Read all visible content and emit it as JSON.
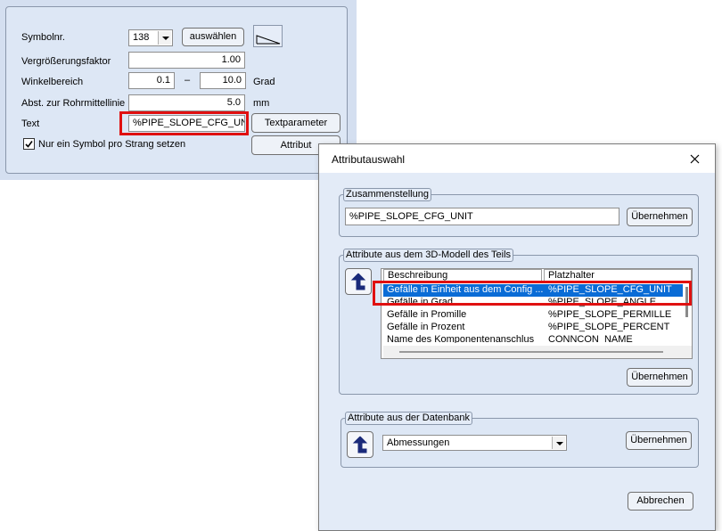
{
  "main_panel": {
    "symbolnr_label": "Symbolnr.",
    "symbolnr_value": "138",
    "select_button": "auswählen",
    "factor_label": "Vergrößerungsfaktor",
    "factor_value": "1.00",
    "angle_label": "Winkelbereich",
    "angle_from": "0.1",
    "angle_dash": "–",
    "angle_to": "10.0",
    "angle_unit": "Grad",
    "distance_label": "Abst. zur Rohrmittellinie",
    "distance_value": "5.0",
    "distance_unit": "mm",
    "text_label": "Text",
    "text_value": "%PIPE_SLOPE_CFG_UNIT",
    "textparam_button": "Textparameter",
    "attribut_button": "Attribut",
    "one_symbol_label": "Nur ein Symbol pro Strang setzen",
    "one_symbol_checked": true
  },
  "dialog": {
    "title": "Attributauswahl",
    "composition": {
      "legend": "Zusammenstellung",
      "value": "%PIPE_SLOPE_CFG_UNIT",
      "apply_button": "Übernehmen"
    },
    "model_attrs": {
      "legend": "Attribute aus dem 3D-Modell des Teils",
      "columns": [
        "Beschreibung",
        "Platzhalter"
      ],
      "rows": [
        {
          "desc": "Gefälle in Einheit aus dem Config ...",
          "placeholder": "%PIPE_SLOPE_CFG_UNIT",
          "selected": true
        },
        {
          "desc": "Gefälle in Grad",
          "placeholder": "%PIPE_SLOPE_ANGLE",
          "selected": false
        },
        {
          "desc": "Gefälle in Promille",
          "placeholder": "%PIPE_SLOPE_PERMILLE",
          "selected": false
        },
        {
          "desc": "Gefälle in Prozent",
          "placeholder": "%PIPE_SLOPE_PERCENT",
          "selected": false
        },
        {
          "desc": "Name des Komponentenanschlus",
          "placeholder": "CONNCON_NAME",
          "selected": false
        }
      ],
      "apply_button": "Übernehmen"
    },
    "db_attrs": {
      "legend": "Attribute aus der Datenbank",
      "selected_value": "Abmessungen",
      "apply_button": "Übernehmen"
    },
    "cancel_button": "Abbrechen"
  },
  "colors": {
    "highlight_red": "#e01010",
    "selection_blue": "#0a6cd6",
    "panel_blue": "#dde7f5",
    "arrow_navy": "#1a2a7a"
  },
  "icons": {
    "symbol_preview": "slope-triangle-icon",
    "up_button": "up-arrow-icon",
    "close": "close-icon",
    "checkbox": "checkmark-icon",
    "combo": "chevron-down-icon"
  }
}
